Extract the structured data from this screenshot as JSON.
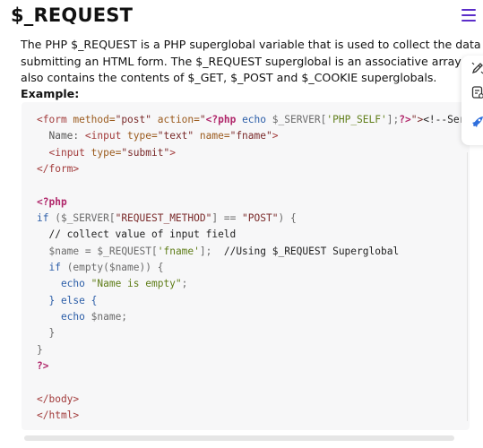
{
  "page": {
    "title": "$_REQUEST",
    "description_lines": [
      "The PHP $_REQUEST is a PHP superglobal variable that is used to collect the data after",
      "submitting an HTML form. The $_REQUEST superglobal is an associative array whic",
      "also contains the contents of $_GET, $_POST and $_COOKIE superglobals."
    ],
    "example_label": "Example:"
  },
  "code": {
    "l1_tag_open": "<form",
    "l1_attr_method": " method=",
    "l1_val_method": "\"post\"",
    "l1_attr_action": " action=",
    "l1_quote_open": "\"",
    "l1_php_open": "<?php",
    "l1_echo": " echo ",
    "l1_server": "$_SERVER[",
    "l1_key": "'PHP_SELF'",
    "l1_close_bracket": "];",
    "l1_php_close": "?>",
    "l1_quote_close": "\">",
    "l1_rest": "<!--Serv",
    "l2_label": "  Name: ",
    "l2_input": "<input",
    "l2_attr_type": " type=",
    "l2_val_type": "\"text\"",
    "l2_attr_name": " name=",
    "l2_val_name": "\"fname\"",
    "l2_end": ">",
    "l3_indent": "  ",
    "l3_input": "<input",
    "l3_attr_type": " type=",
    "l3_val_type": "\"submit\"",
    "l3_end": ">",
    "l4_close": "</form>",
    "l6_php": "<?php",
    "l7_if": "if",
    "l7_paren": " ($_SERVER[",
    "l7_key": "\"REQUEST_METHOD\"",
    "l7_op": "] == ",
    "l7_val": "\"POST\"",
    "l7_end": ") {",
    "l8_comment": "  // collect value of input field",
    "l9_var": "  $name",
    "l9_eq": " = ",
    "l9_req": "$_REQUEST[",
    "l9_key": "'fname'",
    "l9_end": "];",
    "l9_comment": "  //Using $_REQUEST Superglobal",
    "l10_if": "  if",
    "l10_rest": " (empty($name)) {",
    "l11_echo": "    echo",
    "l11_str": " \"Name is empty\"",
    "l11_end": ";",
    "l12_else": "  } else {",
    "l13_echo": "    echo",
    "l13_var": " $name;",
    "l14_close": "  }",
    "l15_close": "}",
    "l16_php_close": "?>",
    "l18_body": "</body>",
    "l19_html": "</html>"
  },
  "icons": {
    "menu": "hamburger-menu-icon",
    "side1": "pen-edit-icon",
    "side2": "document-settings-icon",
    "side3": "rocket-icon"
  },
  "colors": {
    "accent": "#5b2dc9",
    "code_bg": "#f7f7f8"
  }
}
